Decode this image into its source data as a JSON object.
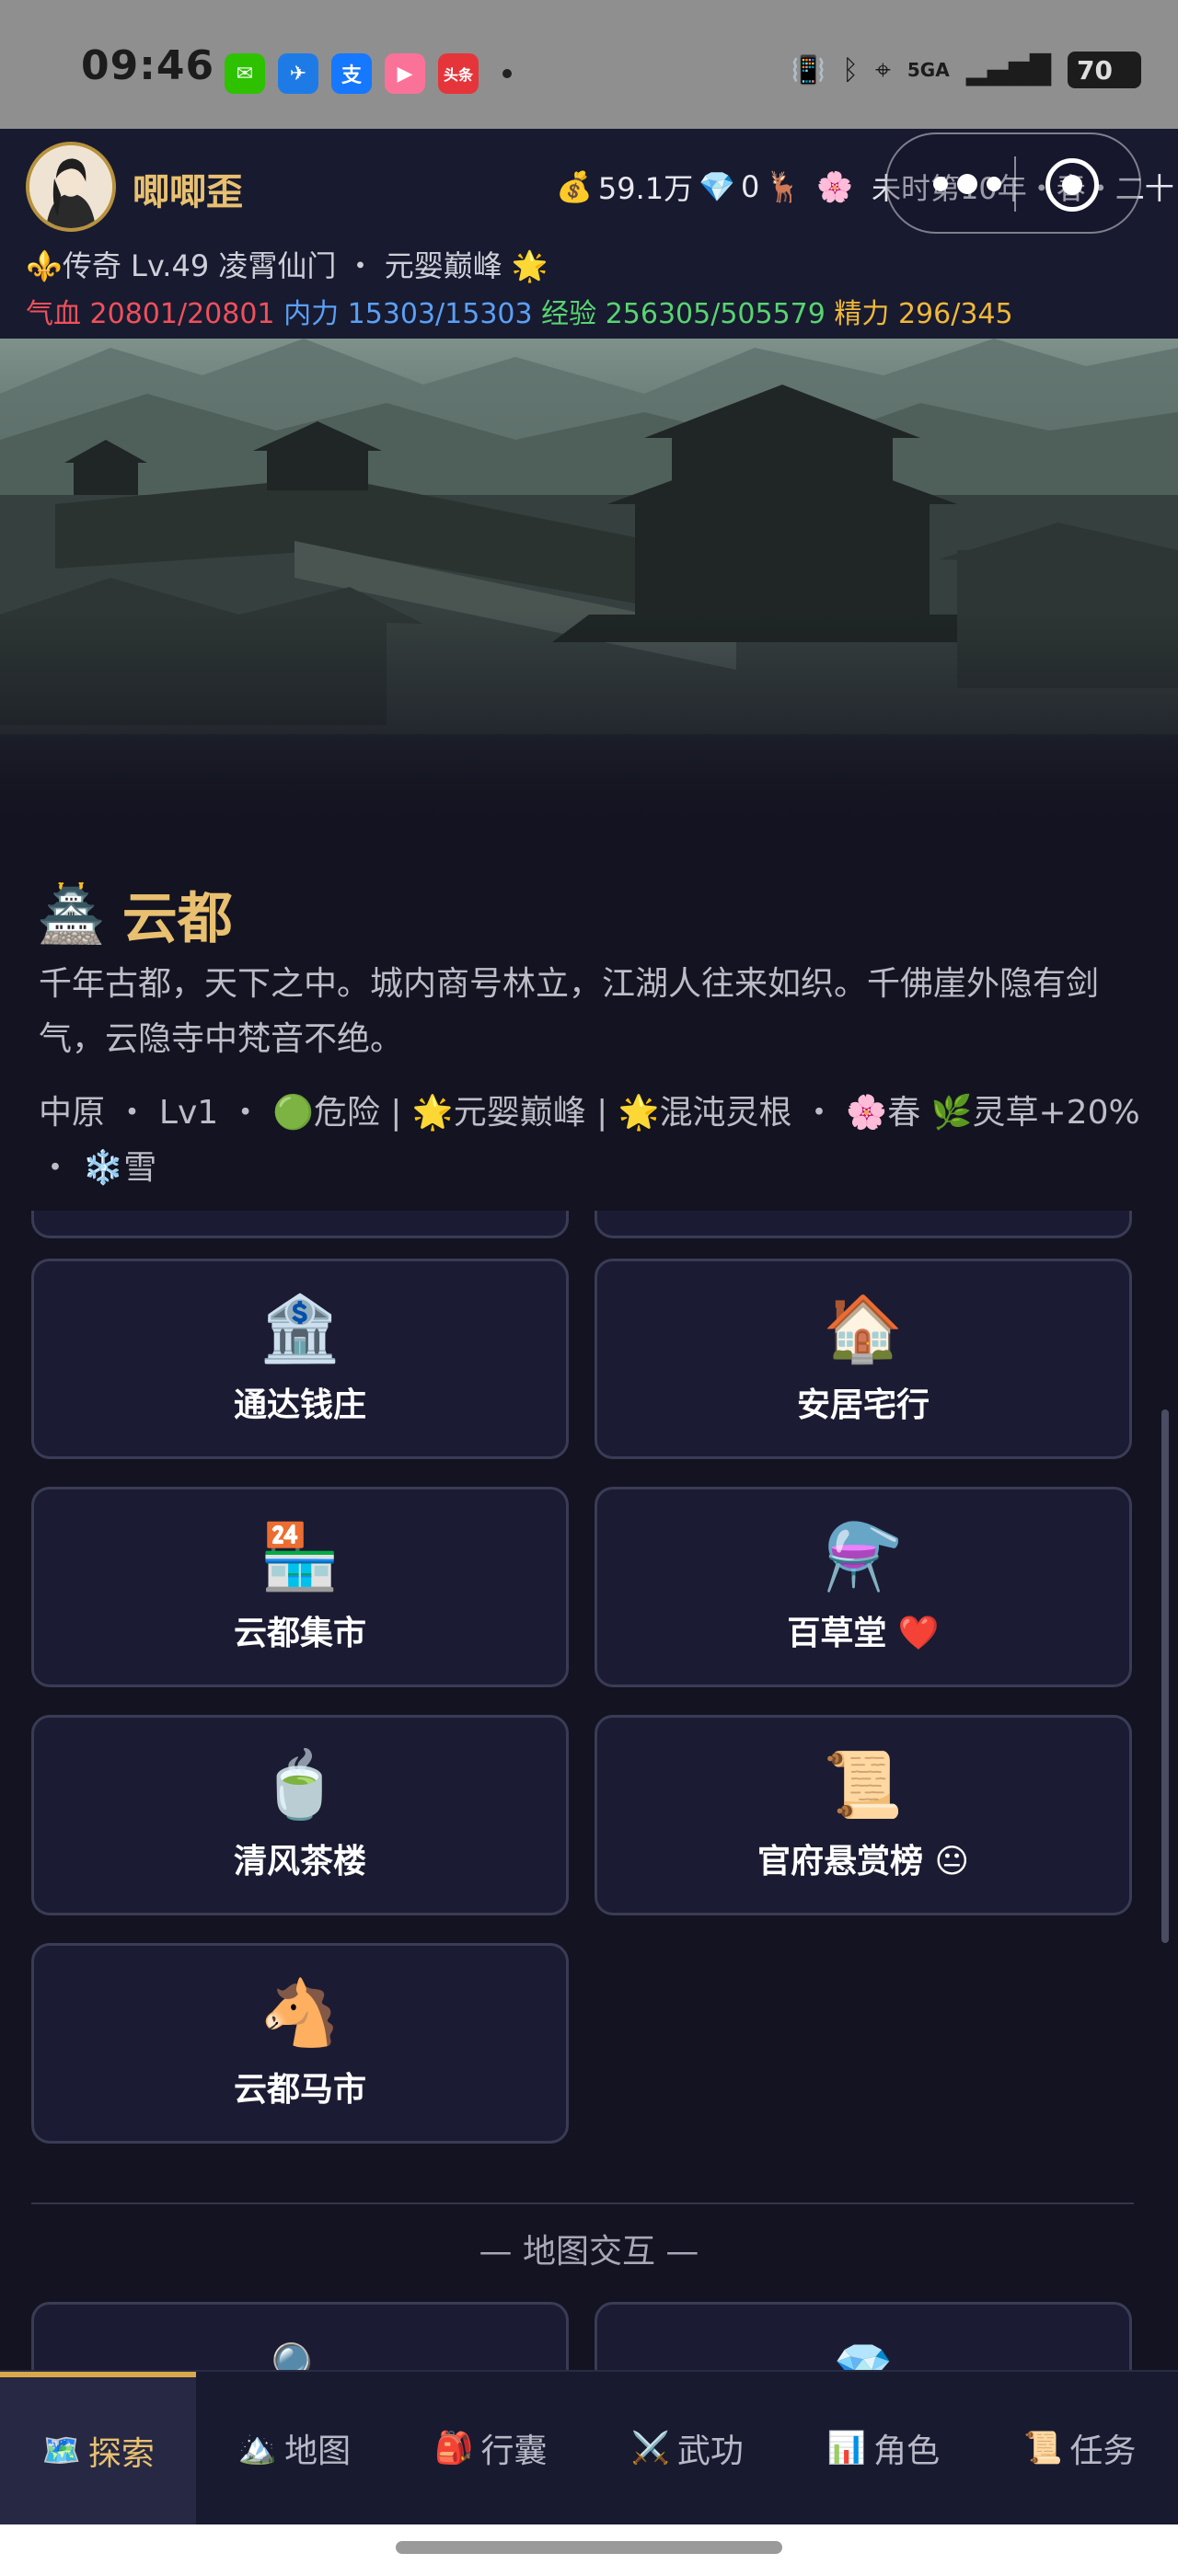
{
  "status_bar": {
    "time": "09:46",
    "apps": [
      {
        "icon": "wechat-icon",
        "glyph": "✉",
        "color": "#2dc100"
      },
      {
        "icon": "travel-app-icon",
        "glyph": "✈",
        "color": "#1e7be6"
      },
      {
        "icon": "alipay-icon",
        "glyph": "支",
        "color": "#1677ff"
      },
      {
        "icon": "bilibili-icon",
        "glyph": "▶",
        "color": "#fb7299"
      },
      {
        "icon": "toutiao-icon",
        "glyph": "头条",
        "color": "#e5353a"
      }
    ],
    "network": "5GA",
    "battery": "70"
  },
  "header": {
    "player_name": "唧唧歪",
    "silver_icon": "💰",
    "silver": "59.1万",
    "gem_icon": "💎",
    "gems": "0",
    "mount_icon": "🦌",
    "season_icon": "🌸",
    "season": "未时第10年・春・二十",
    "rank_icon": "⚜️",
    "rank_line": "传奇 Lv.49 凌霄仙门 ・ 元婴巅峰",
    "rank_star": "🌟",
    "stats": {
      "hp_label": "气血",
      "hp": "20801/20801",
      "mp_label": "内力",
      "mp": "15303/15303",
      "exp_label": "经验",
      "exp": "256305/505579",
      "energy_label": "精力",
      "energy": "296/345"
    }
  },
  "city": {
    "icon": "🏯",
    "name": "云都",
    "description": "千年古都，天下之中。城内商号林立，江湖人往来如织。千佛崖外隐有剑气，云隐寺中梵音不绝。",
    "tags": "中原 ・ Lv1 ・ 🟢危险 | 🌟元婴巅峰 | 🌟混沌灵根 ・ 🌸春 🌿灵草+20% ・ ❄️雪"
  },
  "buildings": [
    {
      "icon": "🏦",
      "label": "通达钱庄"
    },
    {
      "icon": "🏠",
      "label": "安居宅行"
    },
    {
      "icon": "🏪",
      "label": "云都集市"
    },
    {
      "icon": "⚗️",
      "label": "百草堂 ❤️"
    },
    {
      "icon": "🍵",
      "label": "清风茶楼"
    },
    {
      "icon": "📜",
      "label": "官府悬赏榜 😐"
    },
    {
      "icon": "🐴",
      "label": "云都马市"
    }
  ],
  "partial_cards_below": [
    {
      "icon": "🔍"
    },
    {
      "icon": "💎"
    }
  ],
  "section_title": "— 地图交互 —",
  "bottom_nav": [
    {
      "icon": "🗺️",
      "label": "探索",
      "active": true
    },
    {
      "icon": "🏔️",
      "label": "地图",
      "active": false
    },
    {
      "icon": "🎒",
      "label": "行囊",
      "active": false
    },
    {
      "icon": "⚔️",
      "label": "武功",
      "active": false
    },
    {
      "icon": "📊",
      "label": "角色",
      "active": false
    },
    {
      "icon": "📜",
      "label": "任务",
      "active": false
    }
  ]
}
